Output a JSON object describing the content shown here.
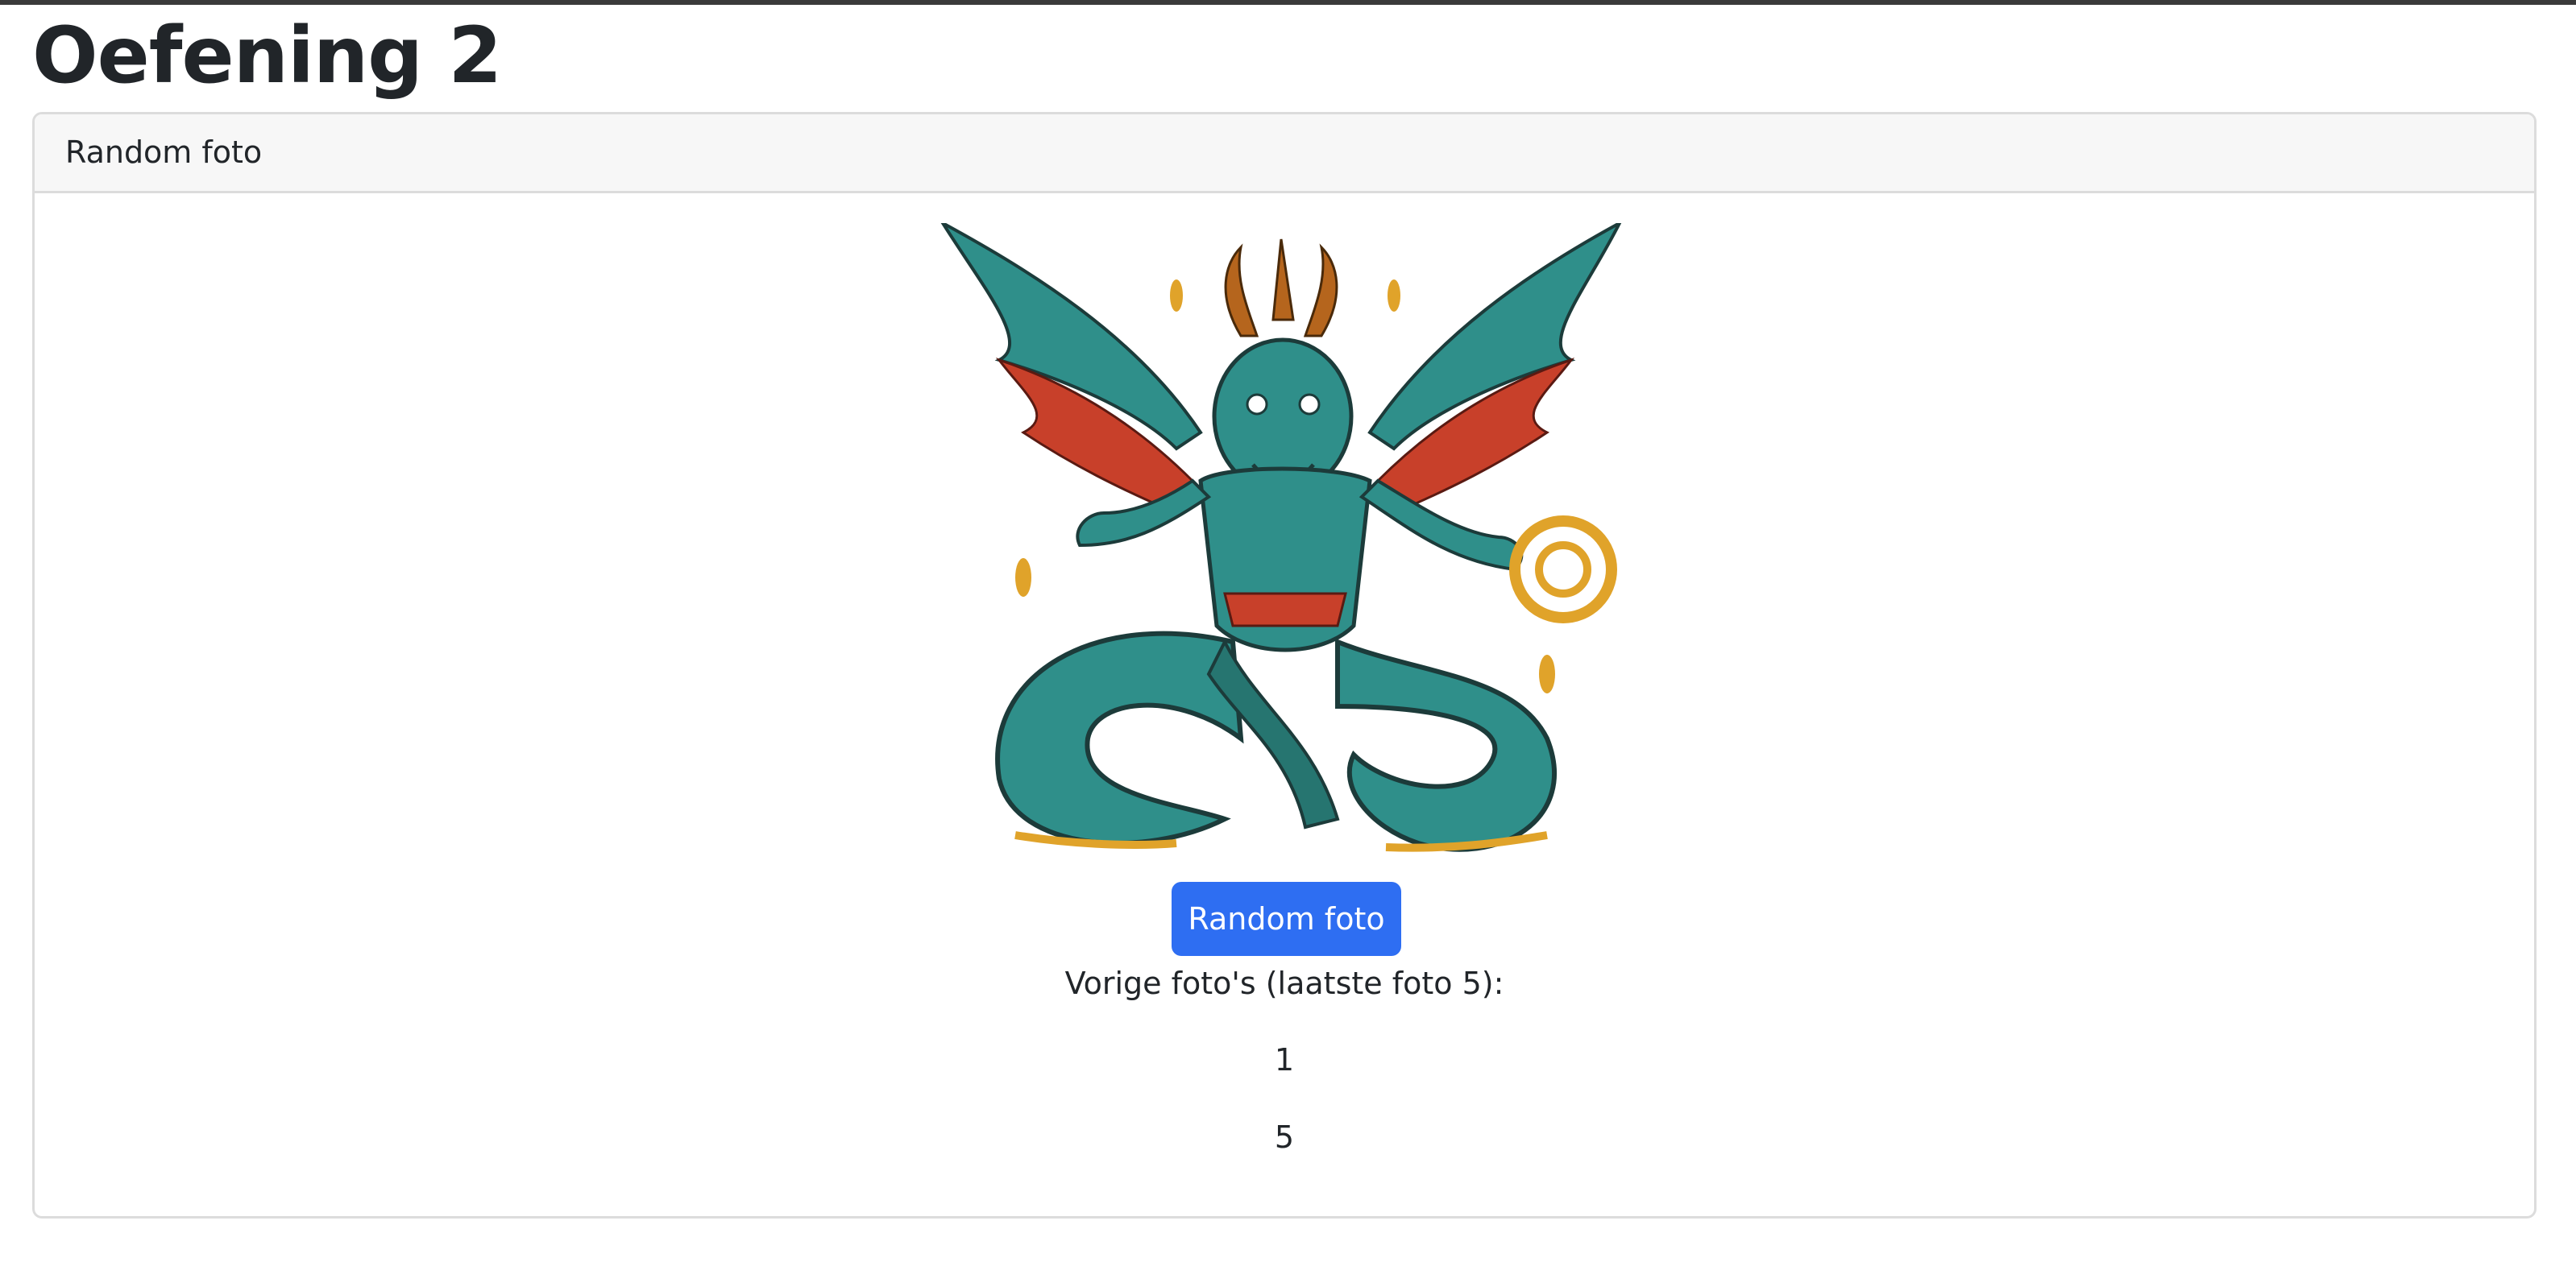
{
  "page": {
    "title": "Oefening 2"
  },
  "card": {
    "header": "Random foto",
    "image": {
      "alt": "dragon-illustration"
    },
    "button_label": "Random foto",
    "previous_label": "Vorige foto's (laatste foto 5):",
    "previous_photos": [
      "1",
      "5"
    ]
  },
  "colors": {
    "button": "#2e6ef2",
    "header_bg": "#f7f7f7",
    "border": "#dcdcdc",
    "text": "#212529"
  }
}
